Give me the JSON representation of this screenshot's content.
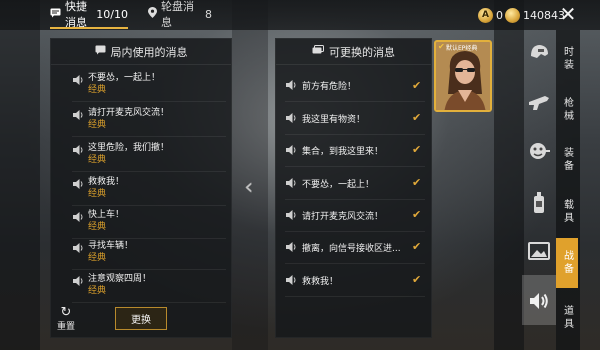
{
  "tabs": [
    {
      "label": "快捷消息",
      "count": "10/10"
    },
    {
      "label": "轮盘消息",
      "count": "8"
    }
  ],
  "currency": {
    "coin_letter": "A",
    "amount1": "0",
    "amount2": "140843"
  },
  "close_label": "✕",
  "left_panel": {
    "title": "局内使用的消息",
    "items": [
      {
        "msg": "不要怂，一起上！",
        "tag": "经典"
      },
      {
        "msg": "请打开麦克风交流！",
        "tag": "经典"
      },
      {
        "msg": "这里危险，我们撤！",
        "tag": "经典"
      },
      {
        "msg": "救救我！",
        "tag": "经典"
      },
      {
        "msg": "快上车！",
        "tag": "经典"
      },
      {
        "msg": "寻找车辆！",
        "tag": "经典"
      },
      {
        "msg": "注意观察四周！",
        "tag": "经典"
      }
    ],
    "reset_label": "重置",
    "swap_label": "更换"
  },
  "right_panel": {
    "title": "可更换的消息",
    "items": [
      {
        "msg": "前方有危险！"
      },
      {
        "msg": "我这里有物资！"
      },
      {
        "msg": "集合，到我这里来！"
      },
      {
        "msg": "不要怂，一起上！"
      },
      {
        "msg": "请打开麦克风交流！"
      },
      {
        "msg": "撤离，向信号接收区进..."
      },
      {
        "msg": "救救我！"
      }
    ]
  },
  "avatar_label": "默认EP经典",
  "categories": [
    {
      "label": "时装",
      "icon": "helmet-icon"
    },
    {
      "label": "枪械",
      "icon": "gun-icon"
    },
    {
      "label": "装备",
      "icon": "pan-icon"
    },
    {
      "label": "载具",
      "icon": "bottle-icon"
    },
    {
      "label": "战备",
      "icon": "picture-icon"
    },
    {
      "label": "道具",
      "icon": "speaker-icon"
    }
  ],
  "colors": {
    "accent": "#e0a12c",
    "gold": "#e2b03c",
    "tag": "#d99f2b"
  }
}
